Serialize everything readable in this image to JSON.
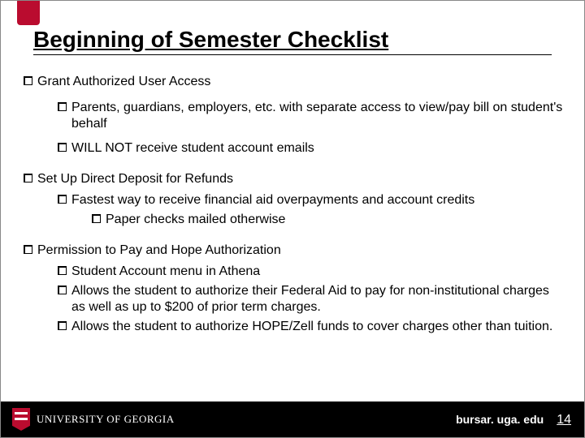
{
  "title": "Beginning of Semester Checklist",
  "sections": {
    "grant": {
      "heading": "Grant Authorized User Access",
      "sub1": "Parents, guardians, employers, etc. with separate access to view/pay bill on student's behalf",
      "sub2": "WILL NOT receive student account emails"
    },
    "deposit": {
      "heading": "Set Up Direct Deposit for Refunds",
      "sub1": "Fastest way to receive financial aid overpayments and account credits",
      "sub1a": "Paper checks mailed otherwise"
    },
    "permission": {
      "heading": "Permission to Pay and Hope Authorization",
      "sub1": "Student Account menu in Athena",
      "sub2": "Allows the student to authorize their Federal Aid to pay for non-institutional charges as well as up to $200 of prior term charges.",
      "sub3": "Allows the student to authorize HOPE/Zell funds to cover charges other than tuition."
    }
  },
  "footer": {
    "wordmark": "UNIVERSITY OF GEORGIA",
    "url": "bursar. uga. edu",
    "page": "14"
  }
}
